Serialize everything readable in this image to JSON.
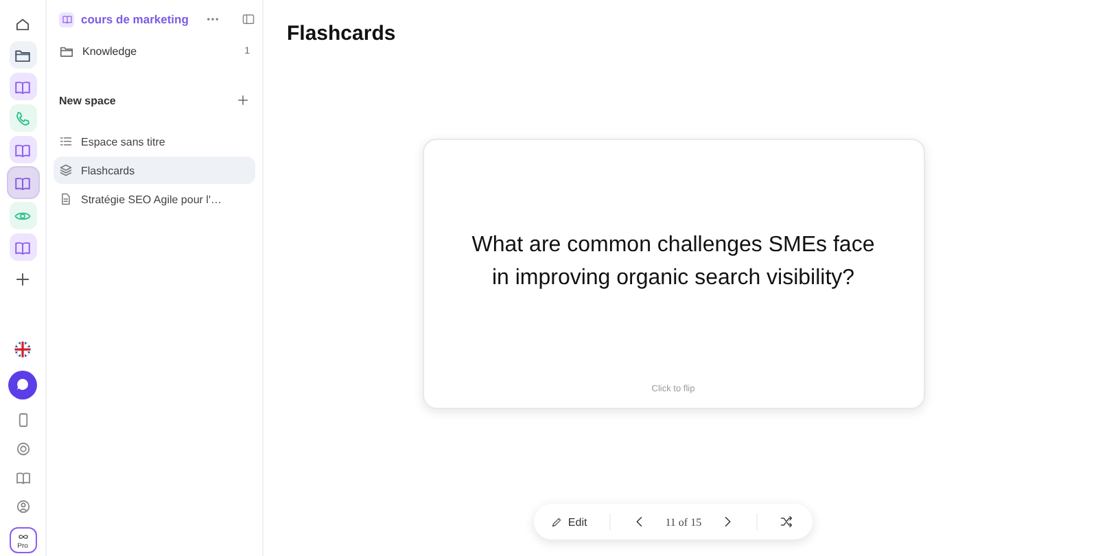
{
  "rail": {
    "top": [
      {
        "kind": "home",
        "color": "#ffffff",
        "selected": false
      },
      {
        "kind": "folder",
        "color": "#eef2f7",
        "selected": false
      },
      {
        "kind": "book",
        "color": "#ede4fd",
        "selected": false
      },
      {
        "kind": "phone",
        "color": "#e6f8ef",
        "selected": false
      },
      {
        "kind": "book",
        "color": "#ede4fd",
        "selected": false
      },
      {
        "kind": "book",
        "color": "#ede4fd",
        "selected": true
      },
      {
        "kind": "eye",
        "color": "#e6f8ef",
        "selected": false
      },
      {
        "kind": "book",
        "color": "#ede4fd",
        "selected": false
      },
      {
        "kind": "plus",
        "color": "#ffffff",
        "selected": false
      }
    ],
    "bottom": [
      {
        "kind": "flag"
      },
      {
        "kind": "chat"
      },
      {
        "kind": "tablet"
      },
      {
        "kind": "support"
      },
      {
        "kind": "book"
      },
      {
        "kind": "user"
      }
    ],
    "pro_label": "Pro"
  },
  "sidebar": {
    "workspace": "cours de marketing",
    "knowledge": {
      "label": "Knowledge",
      "count": "1"
    },
    "section": "New space",
    "items": [
      {
        "kind": "list",
        "label": "Espace sans titre",
        "selected": false
      },
      {
        "kind": "stack",
        "label": "Flashcards",
        "selected": true
      },
      {
        "kind": "doc",
        "label": "Stratégie SEO Agile pour l'…",
        "selected": false
      }
    ]
  },
  "page": {
    "title": "Flashcards",
    "card": {
      "question": "What are common challenges SMEs face in improving organic search visibility?",
      "hint": "Click to flip"
    },
    "toolbar": {
      "edit": "Edit",
      "position": "11 of 15"
    }
  }
}
